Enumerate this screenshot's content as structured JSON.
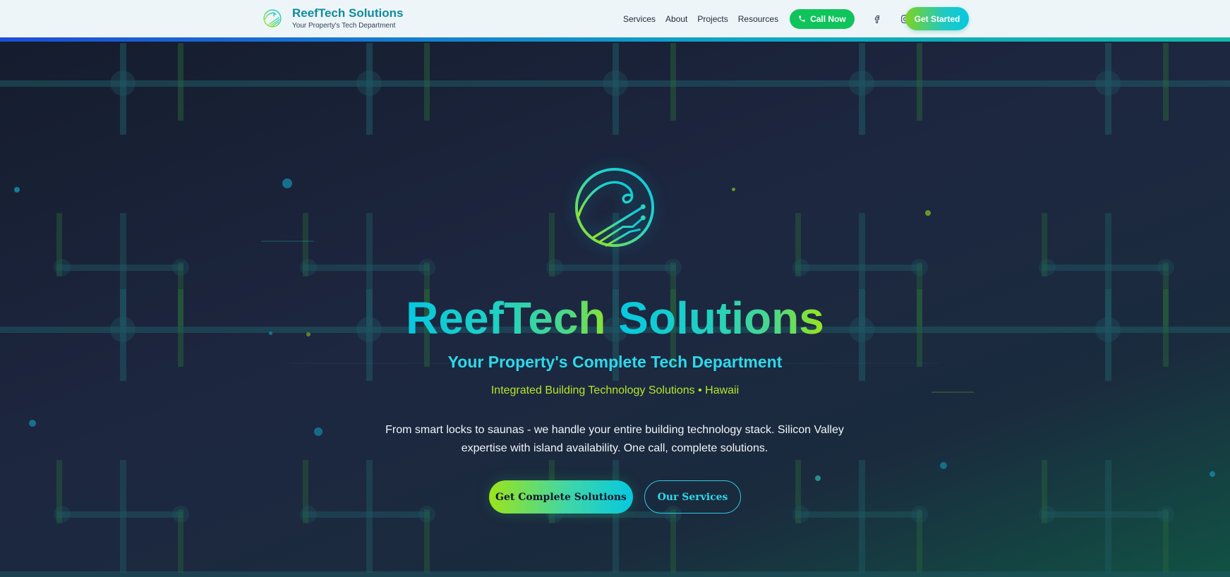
{
  "header": {
    "brand_name": "ReefTech Solutions",
    "brand_tagline": "Your Property's Tech Department",
    "nav": [
      "Services",
      "About",
      "Projects",
      "Resources"
    ],
    "call_label": "Call Now",
    "social_icons": [
      "facebook-icon",
      "instagram-icon"
    ],
    "cta_label": "Get Started"
  },
  "hero": {
    "title_part1": "ReefTech ",
    "title_part2": "Solutions",
    "subtitle": "Your Property's Complete Tech Department",
    "location": "Integrated Building Technology Solutions • Hawaii",
    "description": "From smart locks to saunas - we handle your entire building technology stack. Silicon Valley expertise with island availability. One call, complete solutions.",
    "primary_cta": "Get Complete Solutions",
    "secondary_cta": "Our Services"
  },
  "colors": {
    "brand_teal": "#0e8c9c",
    "call_green": "#10c45c",
    "gradient_cyan": "#06c8e0",
    "gradient_lime": "#9be41a",
    "subtitle_cyan": "#2fd9e9",
    "location_lime": "#b5e82c",
    "hero_bg": "#1b2336"
  }
}
